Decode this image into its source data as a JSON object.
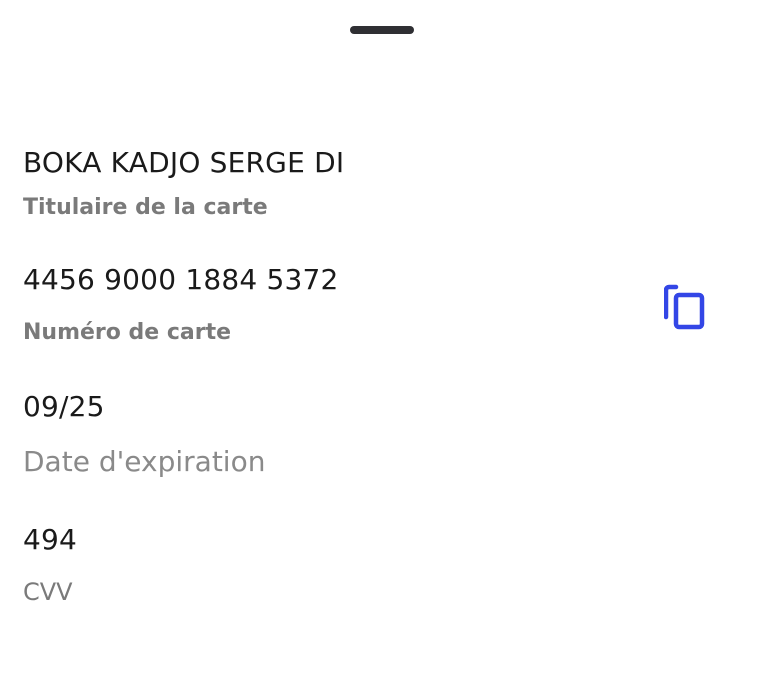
{
  "card": {
    "holder_name": "BOKA KADJO SERGE DI",
    "holder_label": "Titulaire de la carte",
    "number": "4456 9000 1884 5372",
    "number_label": "Numéro de carte",
    "expiry": "09/25",
    "expiry_label": "Date d'expiration",
    "cvv": "494",
    "cvv_label": "CVV"
  },
  "icons": {
    "copy": "copy-icon",
    "drag_handle": "drag-handle"
  },
  "colors": {
    "accent": "#3346e6",
    "text_primary": "#1a1a1a",
    "text_secondary": "#7a7a7a",
    "handle": "#2f2f33"
  }
}
